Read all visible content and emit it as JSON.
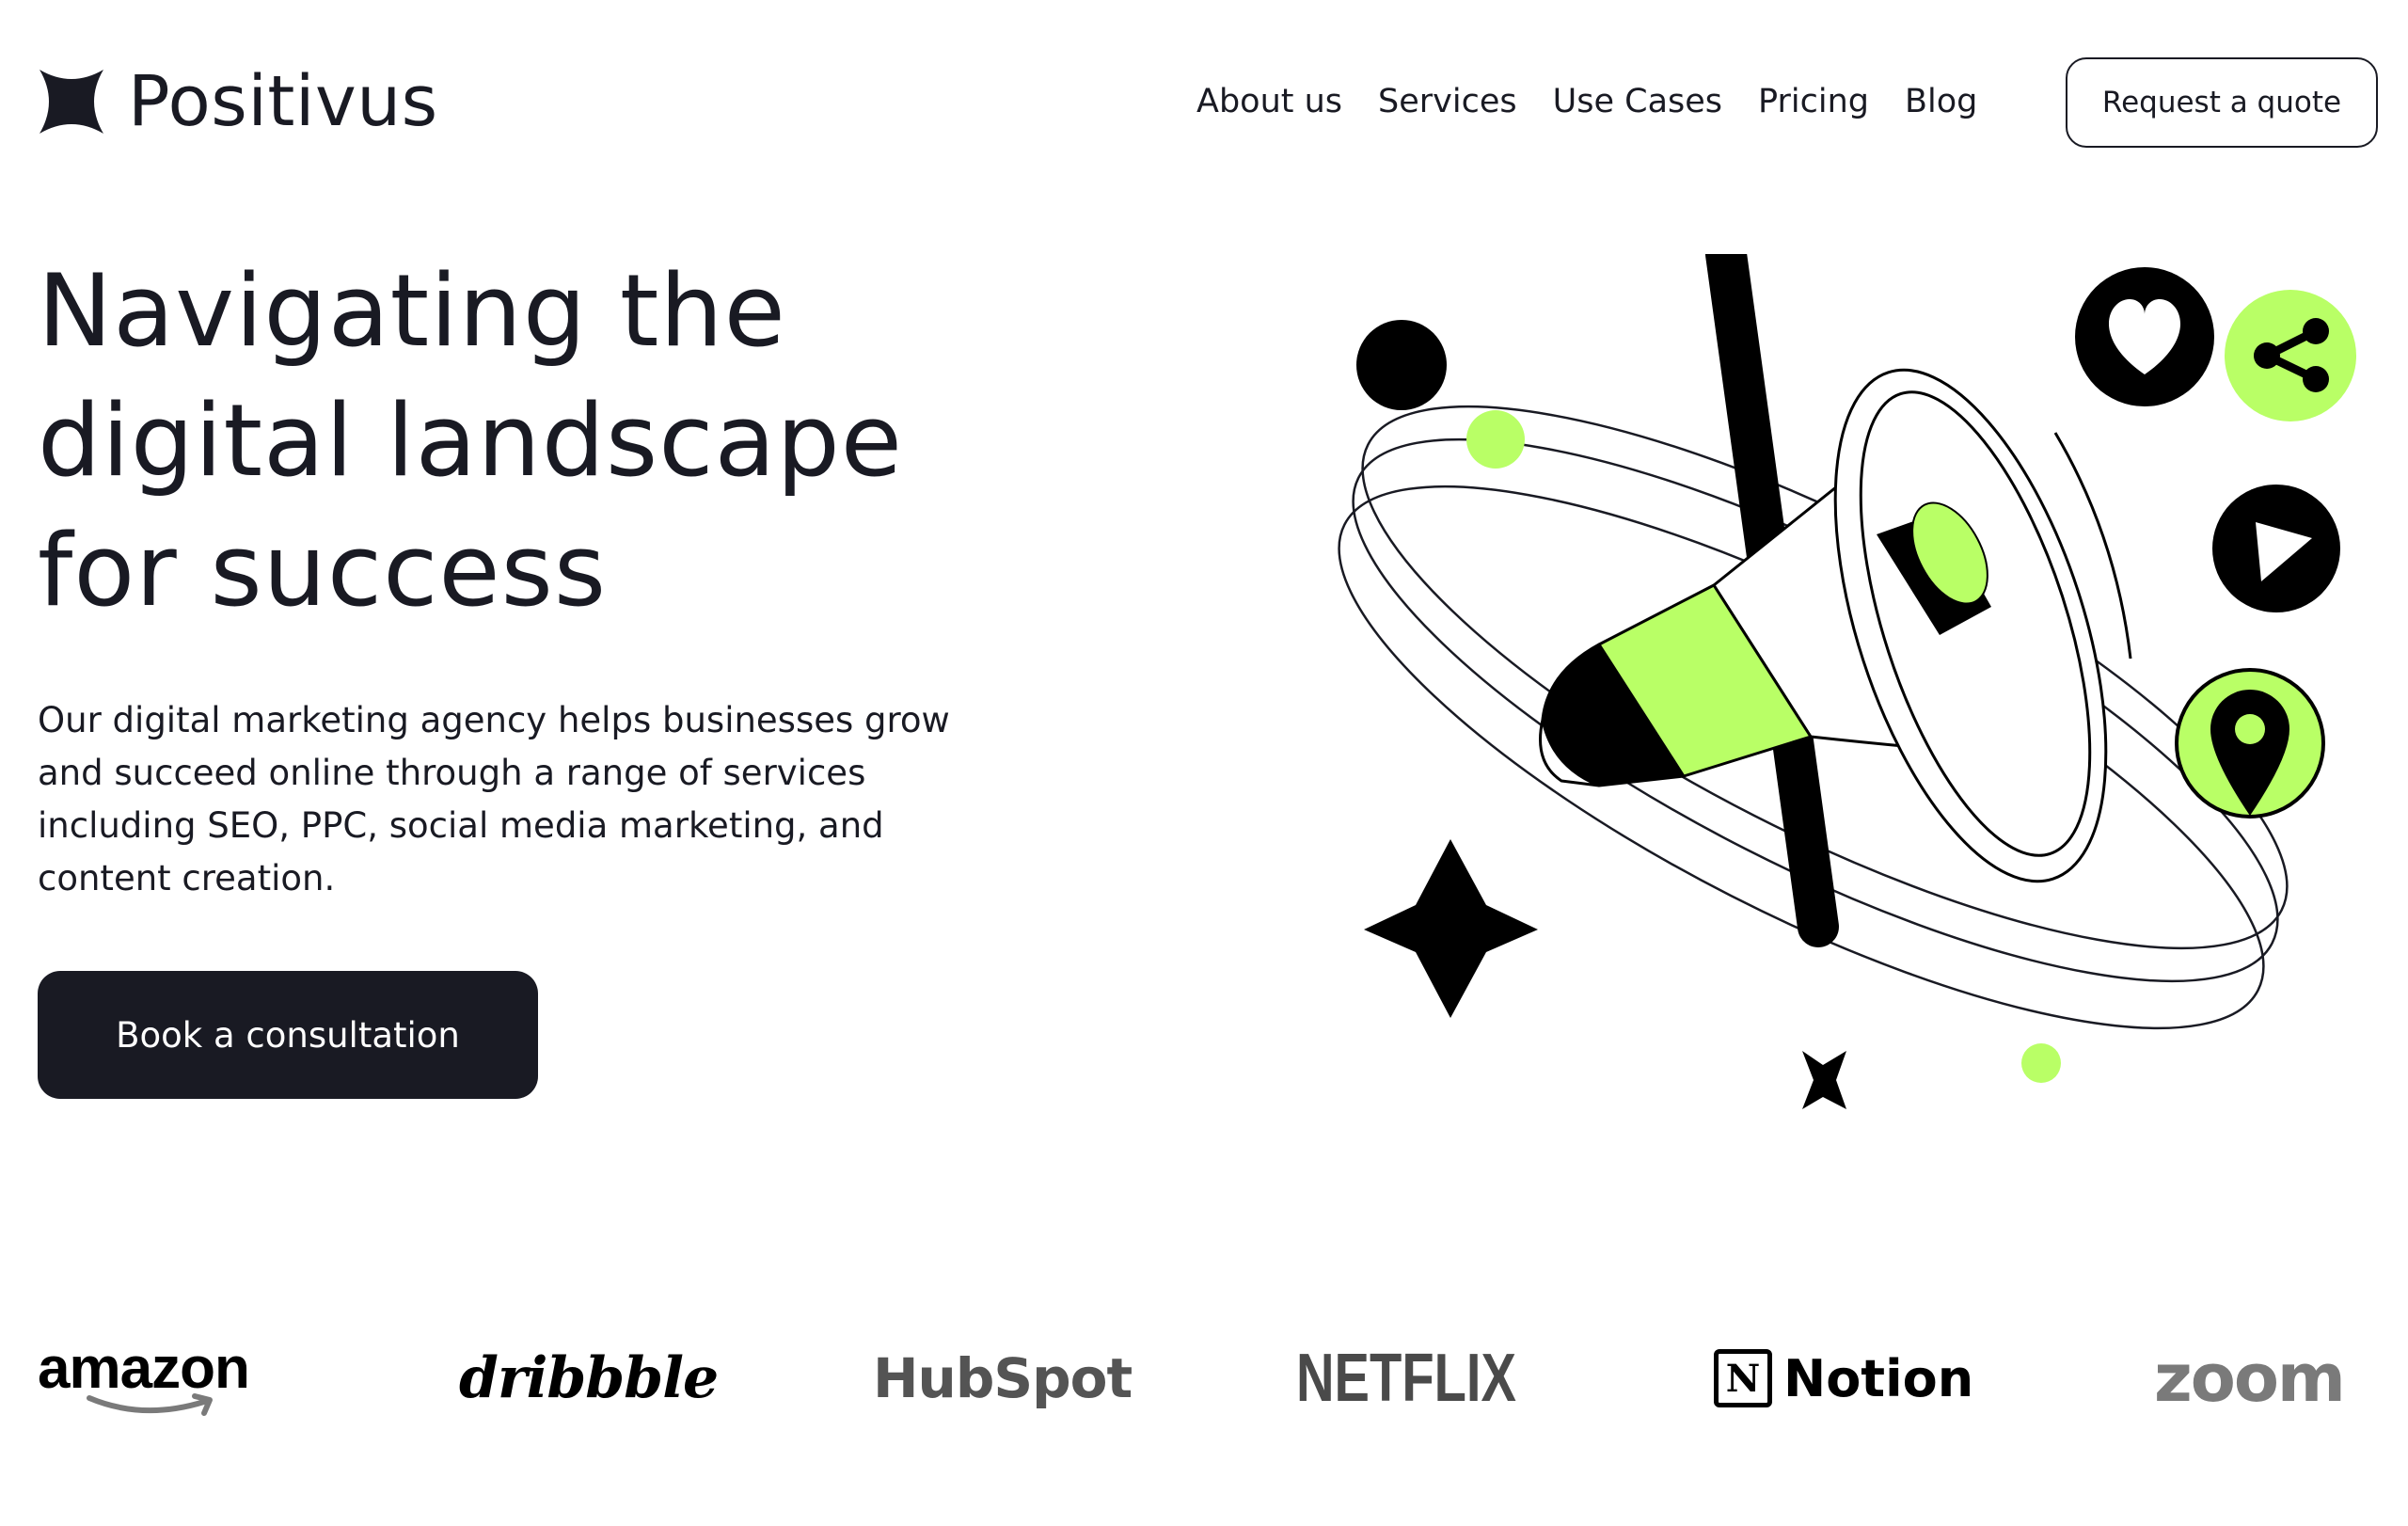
{
  "header": {
    "brand": "Positivus",
    "nav": [
      "About us",
      "Services",
      "Use Cases",
      "Pricing",
      "Blog"
    ],
    "cta_label": "Request a quote"
  },
  "hero": {
    "title": "Navigating the digital landscape for success",
    "description": "Our digital marketing agency helps businesses grow and succeed online through a range of services including SEO, PPC, social media marketing, and content creation.",
    "button_label": "Book a consultation"
  },
  "brands": {
    "amazon": "amazon",
    "dribbble": "dribbble",
    "hubspot": "HubSpot",
    "netflix": "NETFLIX",
    "notion_mark": "N",
    "notion": "Notion",
    "zoom": "zoom"
  },
  "colors": {
    "dark": "#191a23",
    "accent": "#b9ff66",
    "white": "#ffffff"
  },
  "icons": [
    "positivus-logo-icon",
    "megaphone-icon",
    "heart-icon",
    "share-icon",
    "play-icon",
    "location-pin-icon",
    "sparkle-star-icon"
  ]
}
